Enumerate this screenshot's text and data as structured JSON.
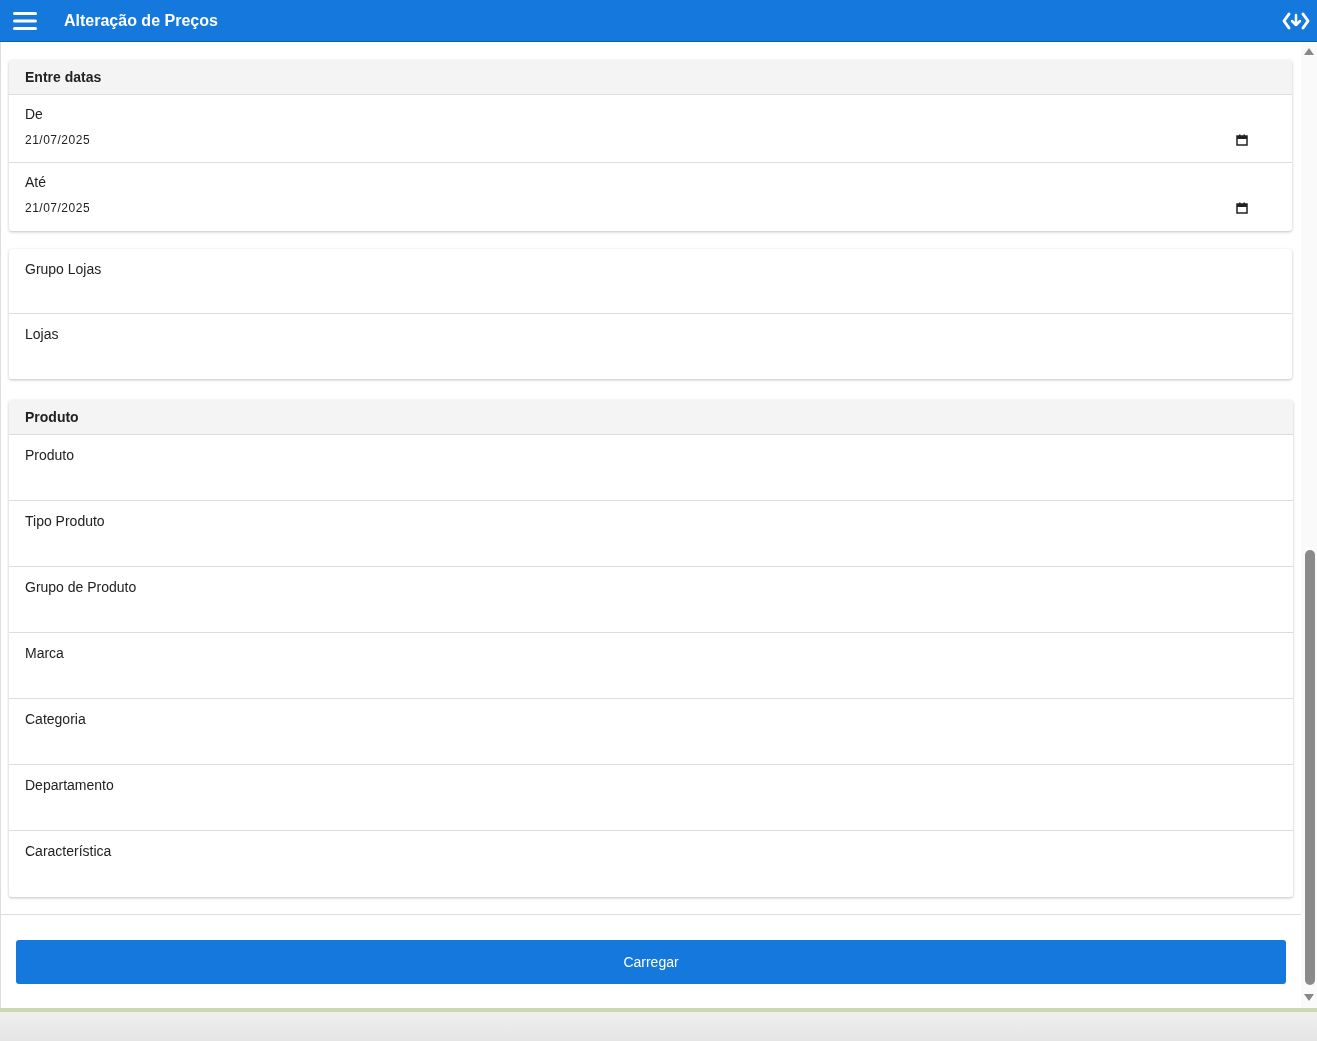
{
  "app_bar": {
    "title": "Alteração de Preços"
  },
  "date_section": {
    "title": "Entre datas",
    "fields": [
      {
        "label": "De",
        "value": "21/07/2025"
      },
      {
        "label": "Até",
        "value": "21/07/2025"
      }
    ]
  },
  "store_section": {
    "fields": [
      {
        "label": "Grupo Lojas"
      },
      {
        "label": "Lojas"
      }
    ]
  },
  "product_section": {
    "title": "Produto",
    "fields": [
      {
        "label": "Produto"
      },
      {
        "label": "Tipo Produto"
      },
      {
        "label": "Grupo de Produto"
      },
      {
        "label": "Marca"
      },
      {
        "label": "Categoria"
      },
      {
        "label": "Departamento"
      },
      {
        "label": "Característica"
      }
    ]
  },
  "load_button": {
    "label": "Carregar"
  }
}
